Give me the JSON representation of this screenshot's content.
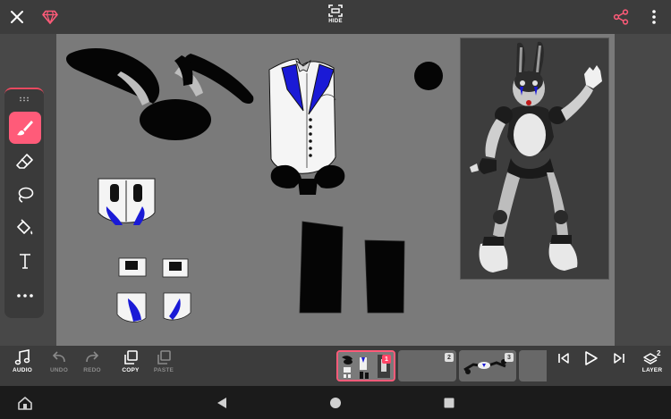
{
  "topbar": {
    "close_icon": "close-icon",
    "premium_icon": "diamond-icon",
    "hide_label": "HIDE",
    "share_icon": "share-icon",
    "more_icon": "more-vertical-icon"
  },
  "palette": {
    "tools": [
      {
        "name": "brush",
        "icon": "brush-icon",
        "active": true
      },
      {
        "name": "eraser",
        "icon": "eraser-icon",
        "active": false
      },
      {
        "name": "lasso",
        "icon": "lasso-icon",
        "active": false
      },
      {
        "name": "fill",
        "icon": "paint-bucket-icon",
        "active": false
      },
      {
        "name": "text",
        "icon": "text-icon",
        "active": false
      },
      {
        "name": "more",
        "icon": "more-horizontal-icon",
        "active": false
      }
    ]
  },
  "bottombar": {
    "audio_label": "AUDIO",
    "undo_label": "UNDO",
    "redo_label": "REDO",
    "copy_label": "COPY",
    "paste_label": "PASTE",
    "layer_label": "LAYER",
    "layer_count": "2"
  },
  "frames": [
    {
      "number": "1",
      "current": true
    },
    {
      "number": "2",
      "current": false
    },
    {
      "number": "3",
      "current": false
    },
    {
      "number": "",
      "current": false
    }
  ],
  "playback": {
    "prev_icon": "skip-previous-icon",
    "play_icon": "play-icon",
    "next_icon": "skip-next-icon"
  },
  "colors": {
    "accent": "#ff5b79",
    "topbar": "#3c3c3c",
    "canvas": "#7a7a7a",
    "suit_blue": "#1a1ad6"
  },
  "navbar": {
    "home_app_icon": "house-icon",
    "back_icon": "back-triangle-icon",
    "home_icon": "home-circle-icon",
    "recents_icon": "recents-square-icon"
  }
}
